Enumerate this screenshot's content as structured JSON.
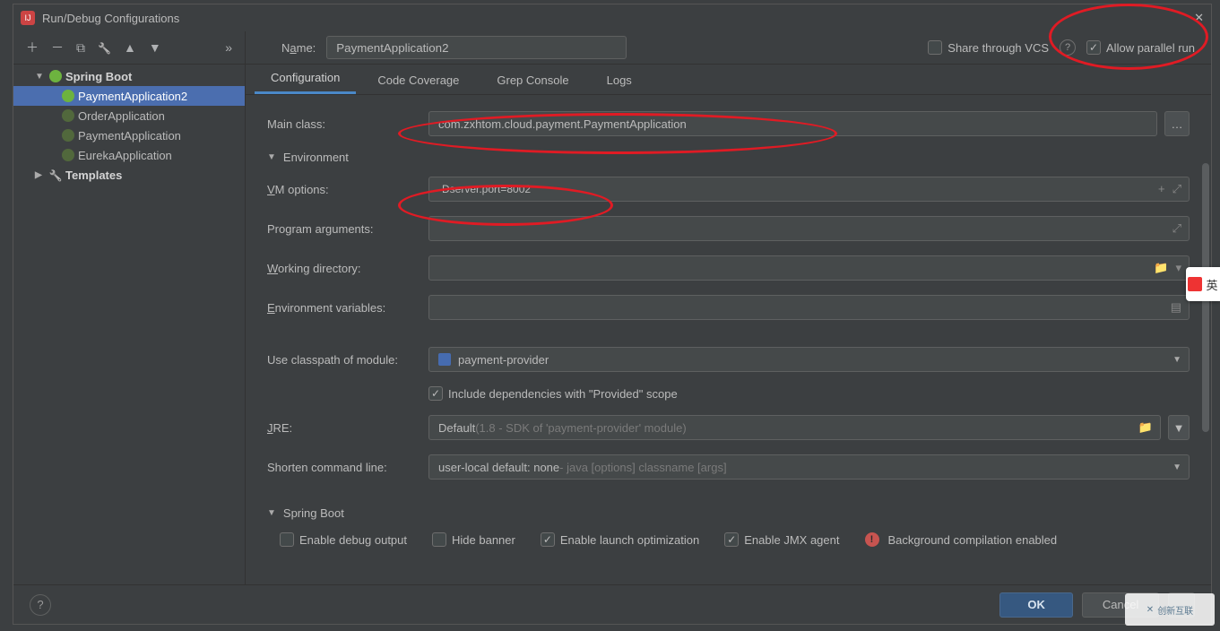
{
  "title": "Run/Debug Configurations",
  "sidebar": {
    "cat_spring": "Spring Boot",
    "items": [
      "PaymentApplication2",
      "OrderApplication",
      "PaymentApplication",
      "EurekaApplication"
    ],
    "cat_templates": "Templates"
  },
  "top": {
    "name_label_pre": "N",
    "name_label_u": "a",
    "name_label_post": "me:",
    "name_value": "PaymentApplication2",
    "share_label_pre": "S",
    "share_label_u": "h",
    "share_label_post": "are through VCS",
    "allow_parallel_pre": "Allow parallel ru",
    "allow_parallel_u": "n",
    "allow_parallel_post": ""
  },
  "tabs": {
    "configuration": "Configuration",
    "coverage": "Code Coverage",
    "grep": "Grep Console",
    "logs": "Logs"
  },
  "form": {
    "main_class_lbl": "Main class:",
    "main_class_val": "com.zxhtom.cloud.payment.PaymentApplication",
    "env_hdr_pre": "Environ",
    "env_hdr_u": "m",
    "env_hdr_post": "ent",
    "vm_lbl_u": "V",
    "vm_lbl_post": "M options:",
    "vm_val": "-Dserver.port=8002",
    "prog_lbl_pre": "Program ar",
    "prog_lbl_u": "g",
    "prog_lbl_post": "uments:",
    "wd_lbl_u": "W",
    "wd_lbl_post": "orking directory:",
    "env_lbl_u": "E",
    "env_lbl_post": "nvironment variables:",
    "cp_lbl": "Use classpath of module:",
    "cp_val": "payment-provider",
    "include_lbl": "Include dependencies with \"Provided\" scope",
    "jre_lbl_u": "J",
    "jre_lbl_post": "RE:",
    "jre_val_main": "Default ",
    "jre_val_dim": "(1.8 - SDK of 'payment-provider' module)",
    "shorten_lbl": "Shorten command line:",
    "shorten_val_main": "user-local default: none ",
    "shorten_val_dim": "- java [options] classname [args]",
    "sb_hdr": "Spring Boot",
    "debug_lbl_pre": "Enable ",
    "debug_lbl_u": "d",
    "debug_lbl_post": "ebug output",
    "hide_lbl_pre": "",
    "hide_lbl_u": "H",
    "hide_lbl_post": "ide banner",
    "launch_lbl": "Enable launch optimization",
    "jmx_lbl_pre": "Enable JM",
    "jmx_lbl_u": "X",
    "jmx_lbl_post": " agent",
    "bg_lbl": "Background compilation enabled"
  },
  "footer": {
    "ok": "OK",
    "cancel": "Cancel"
  },
  "watermark": "创新互联"
}
